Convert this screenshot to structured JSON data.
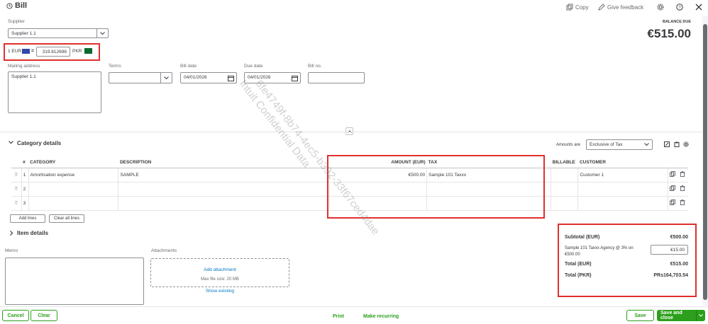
{
  "header": {
    "title": "Bill",
    "copy_label": "Copy",
    "feedback_label": "Give feedback"
  },
  "balance": {
    "label": "BALANCE DUE",
    "amount": "€515.00"
  },
  "supplier": {
    "label": "Supplier",
    "value": "Supplier 1.1"
  },
  "currency": {
    "base": "1 EUR",
    "equals": "=",
    "rate": "319.812696",
    "target": "PKR"
  },
  "mailing": {
    "label": "Mailing address",
    "value": "Supplier 1.1"
  },
  "terms": {
    "label": "Terms",
    "value": ""
  },
  "bill_date": {
    "label": "Bill date",
    "value": "04/01/2026"
  },
  "due_date": {
    "label": "Due date",
    "value": "04/01/2026"
  },
  "bill_no": {
    "label": "Bill no.",
    "value": ""
  },
  "category": {
    "title": "Category details",
    "amounts_are_label": "Amounts are",
    "amounts_are_value": "Exclusive of Tax",
    "columns": [
      "#",
      "CATEGORY",
      "DESCRIPTION",
      "AMOUNT (EUR)",
      "TAX",
      "BILLABLE",
      "CUSTOMER"
    ],
    "rows": [
      {
        "num": "1",
        "category": "Amortisation expense",
        "description": "SAMPLE",
        "amount": "€500.00",
        "tax": "Sample 101 Taxxx",
        "customer": "Customer 1"
      },
      {
        "num": "2",
        "category": "",
        "description": "",
        "amount": "",
        "tax": "",
        "customer": ""
      },
      {
        "num": "3",
        "category": "",
        "description": "",
        "amount": "",
        "tax": "",
        "customer": ""
      }
    ],
    "add_lines": "Add lines",
    "clear_lines": "Clear all lines"
  },
  "item_details": {
    "title": "Item details"
  },
  "memo": {
    "label": "Memo"
  },
  "attachments": {
    "label": "Attachments",
    "add": "Add attachment",
    "max": "Max file size: 20 MB",
    "show": "Show existing"
  },
  "totals": {
    "subtotal_label": "Subtotal (EUR)",
    "subtotal_value": "€500.00",
    "tax_label": "Sample 101 Taxxx Agency @ 3% on €500.00",
    "tax_value": "€15.00",
    "total_eur_label": "Total (EUR)",
    "total_eur_value": "€515.00",
    "total_pkr_label": "Total (PKR)",
    "total_pkr_value": "PRs164,703.54"
  },
  "footer": {
    "cancel": "Cancel",
    "clear": "Clear",
    "print": "Print",
    "recurring": "Make recurring",
    "save": "Save",
    "save_close": "Save and close"
  },
  "watermark": {
    "line1": "6fe4749f-8b74-4ec5-b392-33f67ced4dae",
    "line2": "Intuit Confidential Data"
  },
  "colors": {
    "accent_green": "#2ca01c",
    "highlight_red": "#e0302e"
  }
}
